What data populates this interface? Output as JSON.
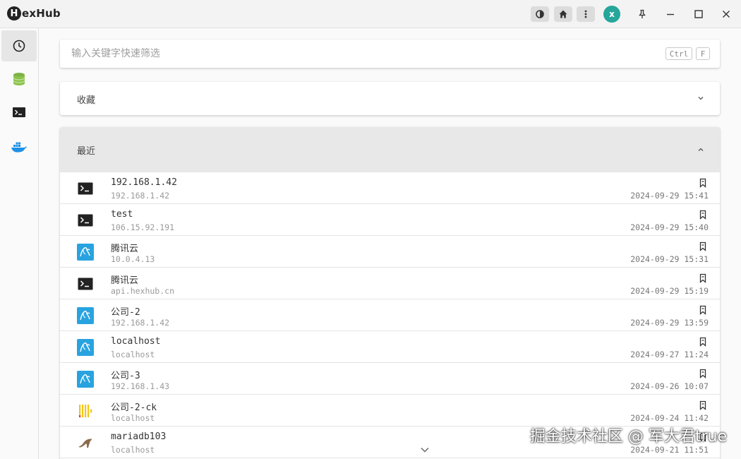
{
  "app": {
    "logo_letter": "H",
    "logo_text": "exHub"
  },
  "titlebar": {
    "avatar_initial": "x",
    "avatar_color": "#26a69a",
    "buttons": [
      "theme-icon",
      "home-icon",
      "more-vert-icon"
    ],
    "window_controls": [
      "pin-icon",
      "minimize-icon",
      "maximize-icon",
      "close-icon"
    ]
  },
  "sidebar": {
    "items": [
      {
        "icon": "history-icon",
        "active": true
      },
      {
        "icon": "database-icon",
        "active": false
      },
      {
        "icon": "terminal-icon",
        "active": false
      },
      {
        "icon": "docker-icon",
        "active": false
      }
    ]
  },
  "search": {
    "placeholder": "输入关键字快速筛选",
    "value": "",
    "shortcut": [
      "Ctrl",
      "F"
    ]
  },
  "favorites": {
    "title": "收藏",
    "expanded": false
  },
  "recent": {
    "title": "最近",
    "expanded": true,
    "items": [
      {
        "type": "ssh",
        "icon": "terminal-icon",
        "name": "192.168.1.42",
        "host": "192.168.1.42",
        "time": "2024-09-29 15:41"
      },
      {
        "type": "ssh",
        "icon": "terminal-icon",
        "name": "test",
        "host": "106.15.92.191",
        "time": "2024-09-29 15:40"
      },
      {
        "type": "mysql",
        "icon": "mysql-icon",
        "name": "腾讯云",
        "host": "10.0.4.13",
        "time": "2024-09-29 15:31"
      },
      {
        "type": "ssh",
        "icon": "terminal-icon",
        "name": "腾讯云",
        "host": "api.hexhub.cn",
        "time": "2024-09-29 15:19"
      },
      {
        "type": "mysql",
        "icon": "mysql-icon",
        "name": "公司-2",
        "host": "192.168.1.42",
        "time": "2024-09-29 13:59"
      },
      {
        "type": "mysql",
        "icon": "mysql-icon",
        "name": "localhost",
        "host": "localhost",
        "time": "2024-09-27 11:24"
      },
      {
        "type": "mysql",
        "icon": "mysql-icon",
        "name": "公司-3",
        "host": "192.168.1.43",
        "time": "2024-09-26 10:07"
      },
      {
        "type": "clickhouse",
        "icon": "clickhouse-icon",
        "name": "公司-2-ck",
        "host": "localhost",
        "time": "2024-09-24 11:42"
      },
      {
        "type": "mariadb",
        "icon": "mariadb-icon",
        "name": "mariadb103",
        "host": "localhost",
        "time": "2024-09-21 11:51"
      }
    ]
  },
  "watermark": "掘金技术社区 @ 军大君true"
}
